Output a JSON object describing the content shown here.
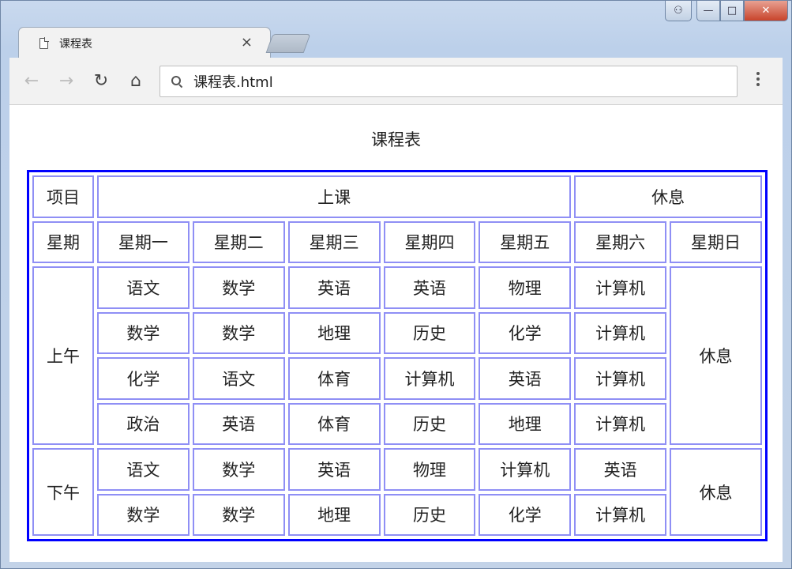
{
  "browser": {
    "tab_title": "课程表",
    "address": "课程表.html",
    "window_buttons": {
      "min": "—",
      "max": "□",
      "close": "✕"
    },
    "nav_icons": [
      "back-icon",
      "forward-icon",
      "reload-icon",
      "home-icon",
      "menu-icon"
    ]
  },
  "page": {
    "caption": "课程表",
    "header_row1": {
      "item": "项目",
      "class": "上课",
      "rest": "休息"
    },
    "header_row2": {
      "label": "星期",
      "days": [
        "星期一",
        "星期二",
        "星期三",
        "星期四",
        "星期五",
        "星期六",
        "星期日"
      ]
    },
    "morning": {
      "label": "上午",
      "sunday": "休息",
      "rows": [
        [
          "语文",
          "数学",
          "英语",
          "英语",
          "物理",
          "计算机"
        ],
        [
          "数学",
          "数学",
          "地理",
          "历史",
          "化学",
          "计算机"
        ],
        [
          "化学",
          "语文",
          "体育",
          "计算机",
          "英语",
          "计算机"
        ],
        [
          "政治",
          "英语",
          "体育",
          "历史",
          "地理",
          "计算机"
        ]
      ]
    },
    "afternoon": {
      "label": "下午",
      "sunday": "休息",
      "rows": [
        [
          "语文",
          "数学",
          "英语",
          "物理",
          "计算机",
          "英语"
        ],
        [
          "数学",
          "数学",
          "地理",
          "历史",
          "化学",
          "计算机"
        ]
      ]
    }
  },
  "colors": {
    "table_border": "#0000ff",
    "cell_border": "#8f8ff5"
  }
}
